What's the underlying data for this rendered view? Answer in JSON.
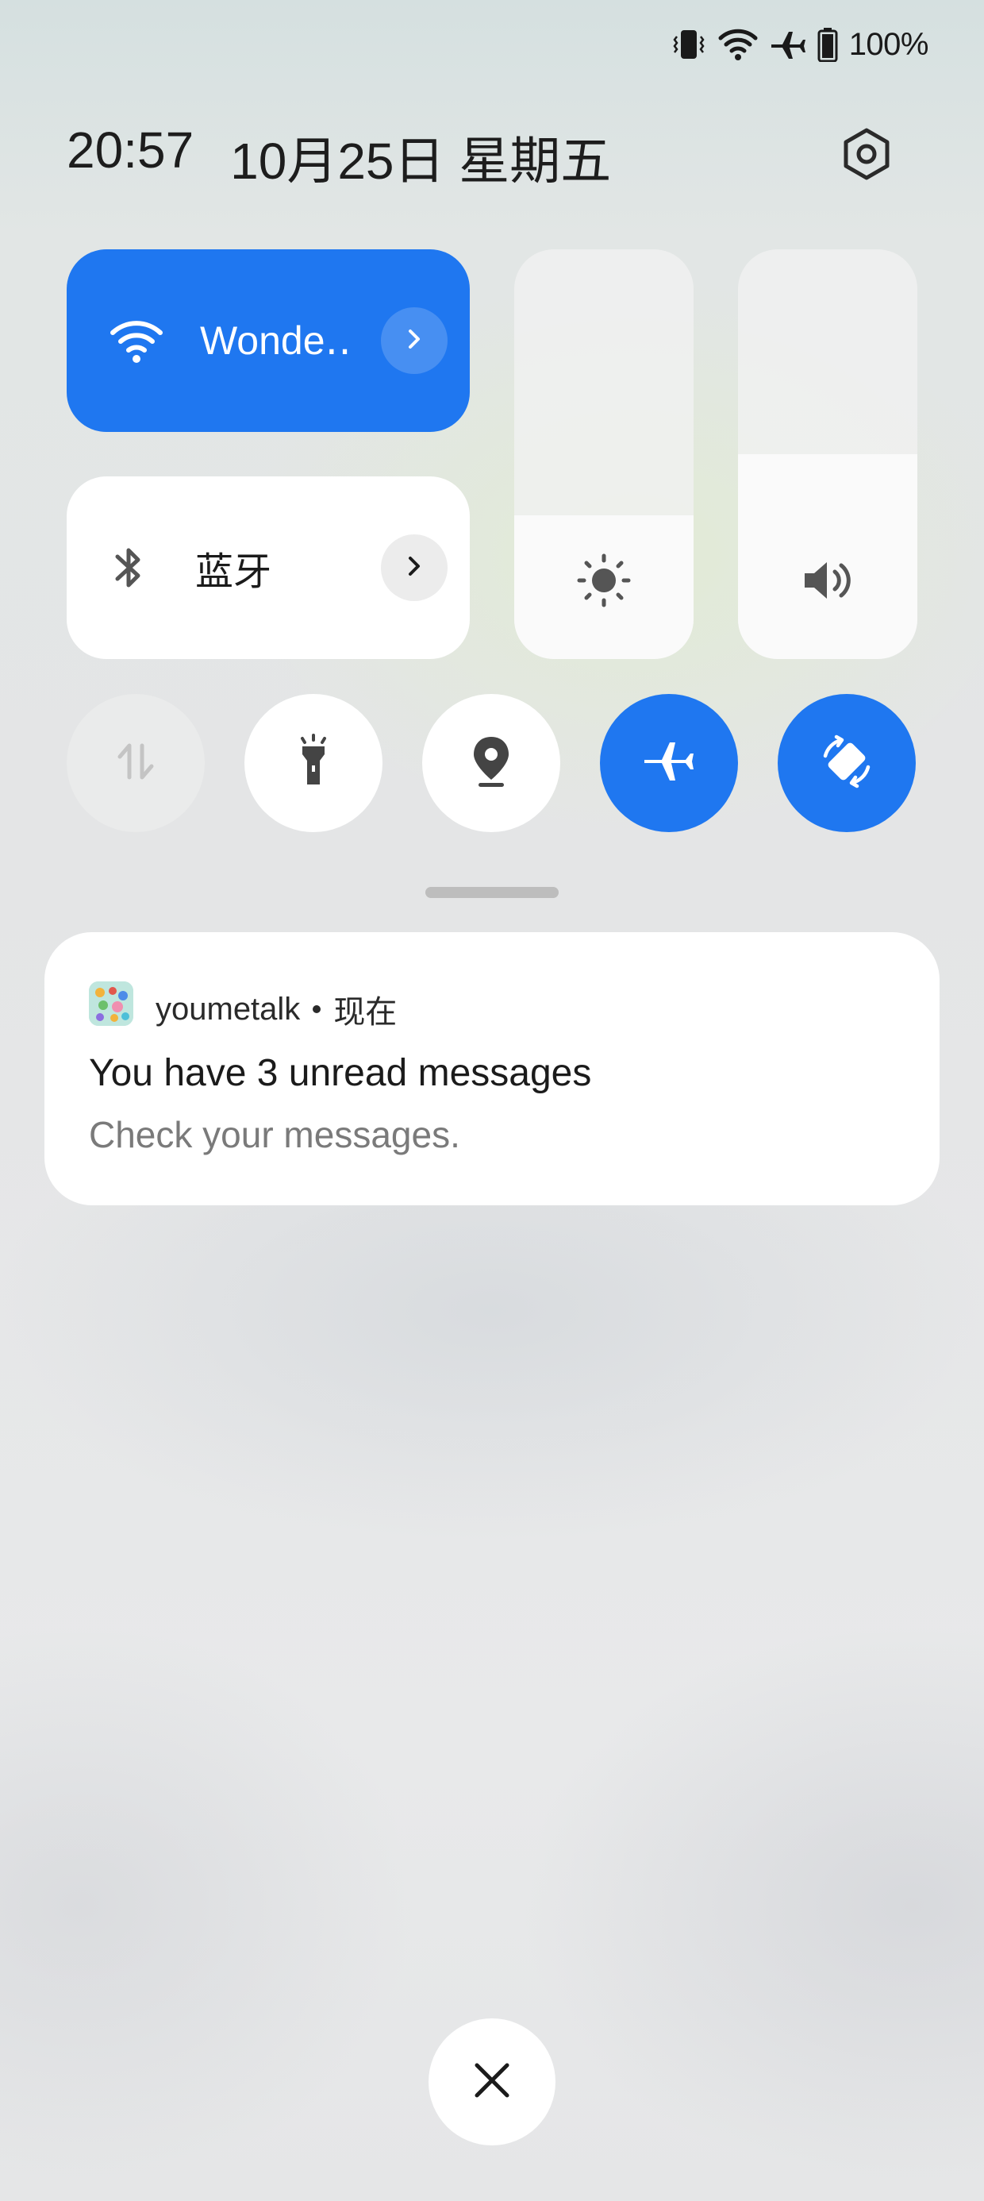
{
  "status_bar": {
    "icons": [
      "vibrate-icon",
      "wifi-icon",
      "airplane-icon",
      "battery-icon"
    ],
    "battery_text": "100%",
    "battery_level": 1.0
  },
  "header": {
    "time": "20:57",
    "date": "10月25日 星期五",
    "settings_icon": "settings-hex-icon"
  },
  "tiles": {
    "wifi": {
      "label": "Wonde‥",
      "state": "on",
      "icon": "wifi-icon",
      "arrow_icon": "chevron-right-icon"
    },
    "bluetooth": {
      "label": "蓝牙",
      "state": "off",
      "icon": "bluetooth-icon",
      "arrow_icon": "chevron-right-icon"
    }
  },
  "sliders": {
    "brightness": {
      "icon": "brightness-icon",
      "level": 0.35
    },
    "volume": {
      "icon": "volume-icon",
      "level": 0.5
    }
  },
  "toggles": [
    {
      "name": "mobile-data",
      "icon": "mobile-data-icon",
      "state": "disabled"
    },
    {
      "name": "flashlight",
      "icon": "flashlight-icon",
      "state": "off"
    },
    {
      "name": "location",
      "icon": "location-icon",
      "state": "off"
    },
    {
      "name": "airplane-mode",
      "icon": "airplane-icon",
      "state": "on"
    },
    {
      "name": "auto-rotate",
      "icon": "auto-rotate-icon",
      "state": "on"
    }
  ],
  "notification": {
    "app_name": "youmetalk",
    "time": "现在",
    "title": "You have 3 unread messages",
    "body": "Check your messages."
  },
  "close_button": {
    "icon": "close-icon"
  },
  "colors": {
    "accent": "#1f77f0",
    "tile_white": "#ffffff",
    "icon_gray": "#555555"
  }
}
